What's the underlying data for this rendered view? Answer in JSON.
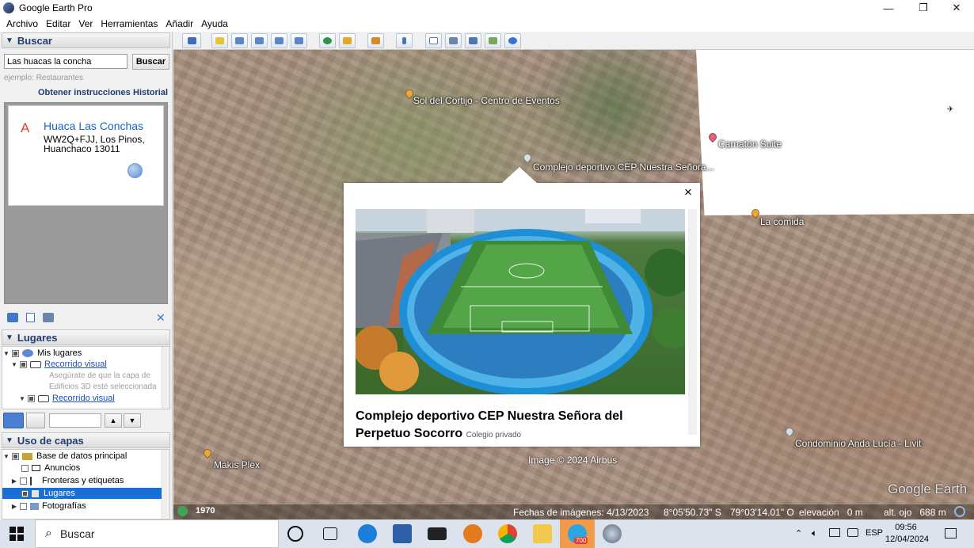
{
  "window": {
    "title": "Google Earth Pro",
    "minimize": "—",
    "maximize": "❐",
    "close": "✕"
  },
  "menu": [
    "Archivo",
    "Editar",
    "Ver",
    "Herramientas",
    "Añadir",
    "Ayuda"
  ],
  "search": {
    "header": "Buscar",
    "query": "Las huacas la concha",
    "button": "Buscar",
    "placeholder_hint": "ejemplo: Restaurantes",
    "directions": "Obtener instrucciones",
    "history": "Historial"
  },
  "result": {
    "marker": "A",
    "title": "Huaca Las Conchas",
    "address_line1": "WW2Q+FJJ, Los Pinos,",
    "address_line2": "Huanchaco 13011"
  },
  "places": {
    "header": "Lugares",
    "items": [
      {
        "label": "Mis lugares"
      },
      {
        "label": "Recorrido visual"
      },
      {
        "label": "Asegúrate de que la capa de"
      },
      {
        "label": "Edificios 3D esté seleccionada"
      },
      {
        "label": "Recorrido visual"
      }
    ]
  },
  "layers": {
    "header": "Uso de capas",
    "items": [
      {
        "label": "Base de datos principal"
      },
      {
        "label": "Anuncios"
      },
      {
        "label": "Fronteras y etiquetas"
      },
      {
        "label": "Lugares"
      },
      {
        "label": "Fotografías"
      }
    ]
  },
  "map": {
    "labels": {
      "sol": "Sol del Cortijo - Centro de Eventos",
      "complejo": "Complejo deportivo CEP Nuestra Señora...",
      "carnaton": "Carnatón Suite",
      "comida": "La comida",
      "makis": "Makis Plex",
      "condominio": "Condominio Anda Lucía - Livit"
    },
    "balloon": {
      "close": "×",
      "title": "Complejo deportivo CEP Nuestra Señora del Perpetuo Socorro",
      "category": "Colegio privado"
    },
    "attribution": "Image © 2024 Airbus",
    "logo": "Google Earth",
    "year": "1970",
    "status": {
      "imagery_date": "Fechas de imágenes: 4/13/2023",
      "lat": "8°05'50.73\" S",
      "lon": "79°03'14.01\" O",
      "elevation": "elevación   0 m",
      "eye_alt": "alt. ojo   688 m"
    }
  },
  "taskbar": {
    "search": "Buscar",
    "telegram_badge": "700",
    "lang": "ESP",
    "time": "09:56",
    "date": "12/04/2024"
  },
  "colors": {
    "accent": "#1d3d70",
    "link": "#1a4fc0",
    "selection": "#1a6fd6",
    "result_title": "#1a63c6"
  }
}
